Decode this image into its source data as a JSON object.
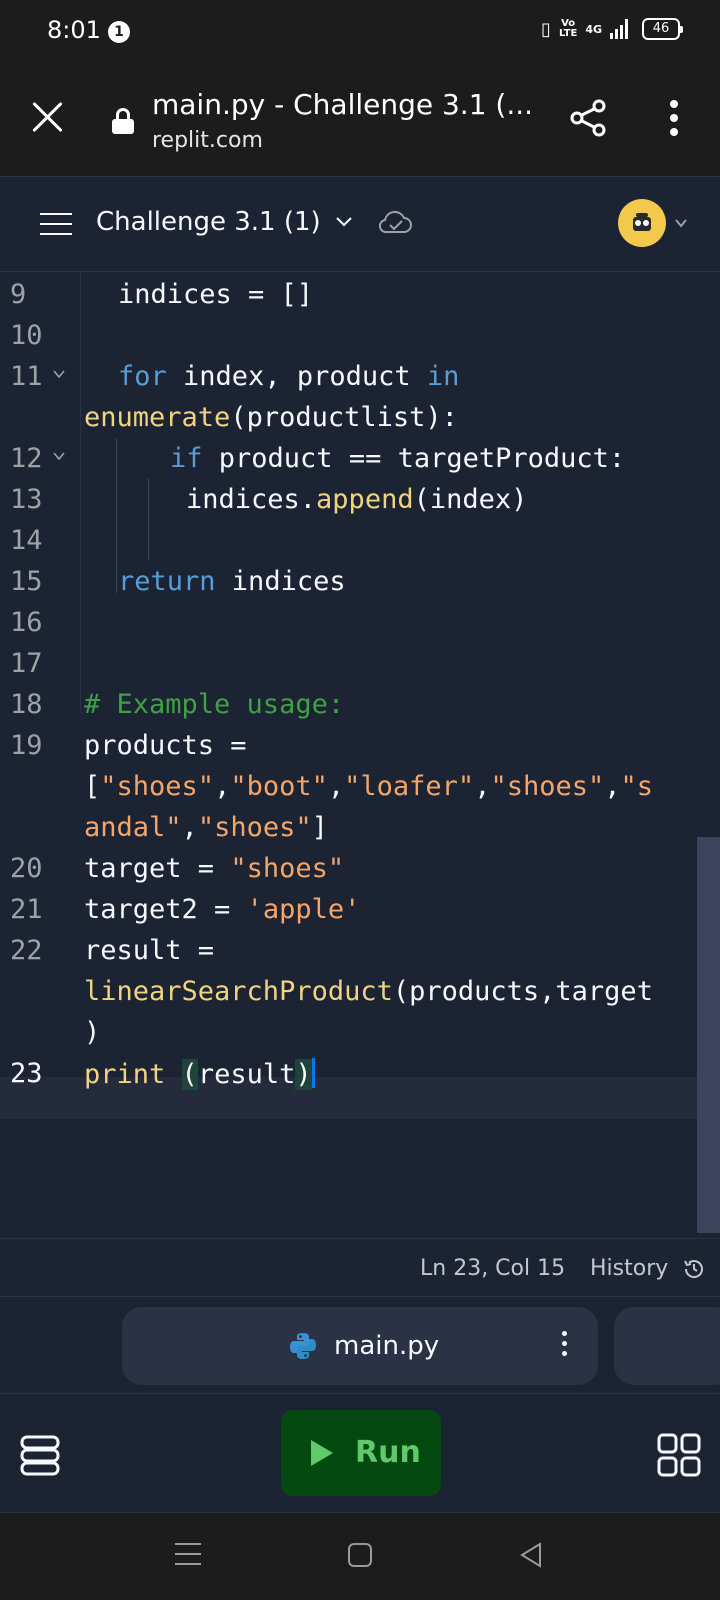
{
  "status_bar": {
    "time": "8:01",
    "notification_count": "1",
    "volte": "Vo\nLTE",
    "network": "4G",
    "battery": "46"
  },
  "browser": {
    "page_title": "main.py - Challenge 3.1 (...",
    "url": "replit.com"
  },
  "replit_header": {
    "repl_name": "Challenge 3.1 (1)"
  },
  "editor": {
    "lines": [
      {
        "num": "9"
      },
      {
        "num": "10"
      },
      {
        "num": "11"
      },
      {
        "num": "12"
      },
      {
        "num": "13"
      },
      {
        "num": "14"
      },
      {
        "num": "15"
      },
      {
        "num": "16"
      },
      {
        "num": "17"
      },
      {
        "num": "18"
      },
      {
        "num": "19"
      },
      {
        "num": "20"
      },
      {
        "num": "21"
      },
      {
        "num": "22"
      },
      {
        "num": "23"
      }
    ],
    "code": {
      "l9": "indices = []",
      "l11_for": "for",
      "l11_vars": " index, product ",
      "l11_in": "in",
      "l11b_fn": "enumerate",
      "l11b_rest": "(productlist):",
      "l12_if": "if",
      "l12_rest": " product == targetProduct:",
      "l13_obj": "indices.",
      "l13_fn": "append",
      "l13_rest": "(index)",
      "l15_kw": "return",
      "l15_rest": " indices",
      "l18": "# Example usage:",
      "l19a": "products =",
      "l19b_open": "[",
      "l19b_s1": "\"shoes\"",
      "l19b_c1": ",",
      "l19b_s2": "\"boot\"",
      "l19b_c2": ",",
      "l19b_s3": "\"loafer\"",
      "l19b_c3": ",",
      "l19b_s4": "\"shoes\"",
      "l19b_c4": ",",
      "l19b_s5a": "\"s",
      "l19c_s5b": "andal\"",
      "l19c_c5": ",",
      "l19c_s6": "\"shoes\"",
      "l19c_close": "]",
      "l20_var": "target = ",
      "l20_str": "\"shoes\"",
      "l21_var": "target2 = ",
      "l21_str": "'apple'",
      "l22a": "result =",
      "l22b_fn": "linearSearchProduct",
      "l22b_rest": "(products,target",
      "l22c": ")",
      "l23_fn": "print",
      "l23_sp": " ",
      "l23_open": "(",
      "l23_arg": "result",
      "l23_close": ")"
    }
  },
  "editor_status": {
    "cursor_position": "Ln 23, Col 15",
    "history_label": "History"
  },
  "file_tabs": {
    "active_file": "main.py"
  },
  "toolbar": {
    "run_label": "Run"
  },
  "icons": {
    "close": "close-icon",
    "lock": "lock-icon",
    "share": "share-icon",
    "more": "more-vert-icon",
    "menu": "hamburger-icon",
    "cloud": "cloud-check-icon",
    "python": "python-icon",
    "database": "database-icon",
    "run": "play-icon",
    "grid": "grid-icon",
    "history": "history-icon"
  },
  "colors": {
    "background": "#1c2333",
    "run_button": "#044a10",
    "run_text": "#5fc96b",
    "keyword": "#569cd6",
    "function": "#f0d47f",
    "string": "#f4a66a",
    "comment": "#3fa046",
    "cursor": "#0079f2"
  }
}
